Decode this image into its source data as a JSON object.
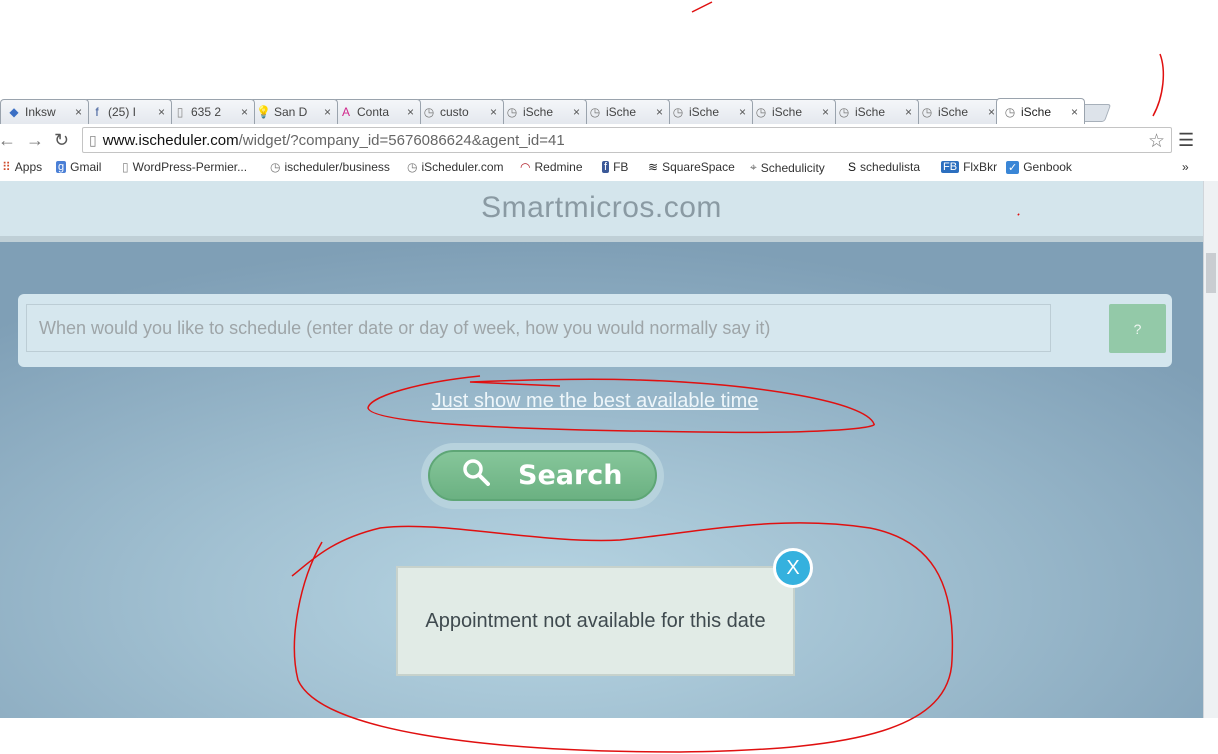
{
  "browser": {
    "tabs": [
      {
        "icon": "inkscape-icon",
        "glyph": "◆",
        "color": "#3b6fc4",
        "title": "Inksw"
      },
      {
        "icon": "facebook-icon",
        "glyph": "f",
        "color": "#3b5998",
        "title": "(25) I"
      },
      {
        "icon": "page-icon",
        "glyph": "▯",
        "color": "#888888",
        "title": "635 2"
      },
      {
        "icon": "lightbulb-icon",
        "glyph": "💡",
        "color": "#e2c000",
        "title": "San D"
      },
      {
        "icon": "a-logo-icon",
        "glyph": "A",
        "color": "#d0278b",
        "title": "Conta"
      },
      {
        "icon": "clock-icon",
        "glyph": "◷",
        "color": "#777777",
        "title": "custo"
      },
      {
        "icon": "clock-icon",
        "glyph": "◷",
        "color": "#777777",
        "title": "iSche"
      },
      {
        "icon": "clock-icon",
        "glyph": "◷",
        "color": "#777777",
        "title": "iSche"
      },
      {
        "icon": "clock-icon",
        "glyph": "◷",
        "color": "#777777",
        "title": "iSche"
      },
      {
        "icon": "clock-icon",
        "glyph": "◷",
        "color": "#777777",
        "title": "iSche"
      },
      {
        "icon": "clock-icon",
        "glyph": "◷",
        "color": "#777777",
        "title": "iSche"
      },
      {
        "icon": "clock-icon",
        "glyph": "◷",
        "color": "#777777",
        "title": "iSche"
      },
      {
        "icon": "clock-icon",
        "glyph": "◷",
        "color": "#777777",
        "title": "iSche",
        "active": true
      }
    ],
    "url_host": "www.ischeduler.com",
    "url_path": "/widget/?company_id=5676086624&agent_id=41",
    "bookmarks": [
      {
        "icon": "apps-icon",
        "glyph": "⠿",
        "color": "#d04a2b",
        "label": "Apps"
      },
      {
        "icon": "google-icon",
        "glyph": "g",
        "color": "#ffffff",
        "bg": "#4a7fd6",
        "label": "Gmail"
      },
      {
        "icon": "page-icon",
        "glyph": "▯",
        "color": "#888888",
        "label": "WordPress-Permier..."
      },
      {
        "icon": "clock-icon",
        "glyph": "◷",
        "color": "#777777",
        "label": "ischeduler/business"
      },
      {
        "icon": "clock-icon",
        "glyph": "◷",
        "color": "#777777",
        "label": "iScheduler.com"
      },
      {
        "icon": "redmine-icon",
        "glyph": "◠",
        "color": "#b2212b",
        "label": "Redmine"
      },
      {
        "icon": "facebook-icon",
        "glyph": "f",
        "color": "#ffffff",
        "bg": "#3b5998",
        "label": "FB"
      },
      {
        "icon": "squarespace-icon",
        "glyph": "≋",
        "color": "#222222",
        "label": "SquareSpace"
      },
      {
        "icon": "schedulicity-icon",
        "glyph": "⌖",
        "color": "#666666",
        "label": "Schedulicity"
      },
      {
        "icon": "schedulista-icon",
        "glyph": "S",
        "color": "#111111",
        "label": "schedulista"
      },
      {
        "icon": "flxbkr-icon",
        "glyph": "FB",
        "color": "#ffffff",
        "bg": "#2c6fbf",
        "label": "FlxBkr"
      },
      {
        "icon": "genbook-icon",
        "glyph": "✓",
        "color": "#ffffff",
        "bg": "#3a86d6",
        "label": "Genbook"
      }
    ],
    "more_bookmarks": "»"
  },
  "page": {
    "site_title": "Smartmicros.com",
    "schedule_placeholder": "When would you like to schedule (enter date or day of week, how you would normally say it)",
    "help_label": "?",
    "best_time_link": "Just show me the best available time",
    "search_label": "Search",
    "alert_text": "Appointment not available for this date",
    "close_label": "X"
  },
  "colors": {
    "search_green": "#6bb182",
    "close_blue": "#35b1de",
    "annotation_red": "#e01010"
  }
}
